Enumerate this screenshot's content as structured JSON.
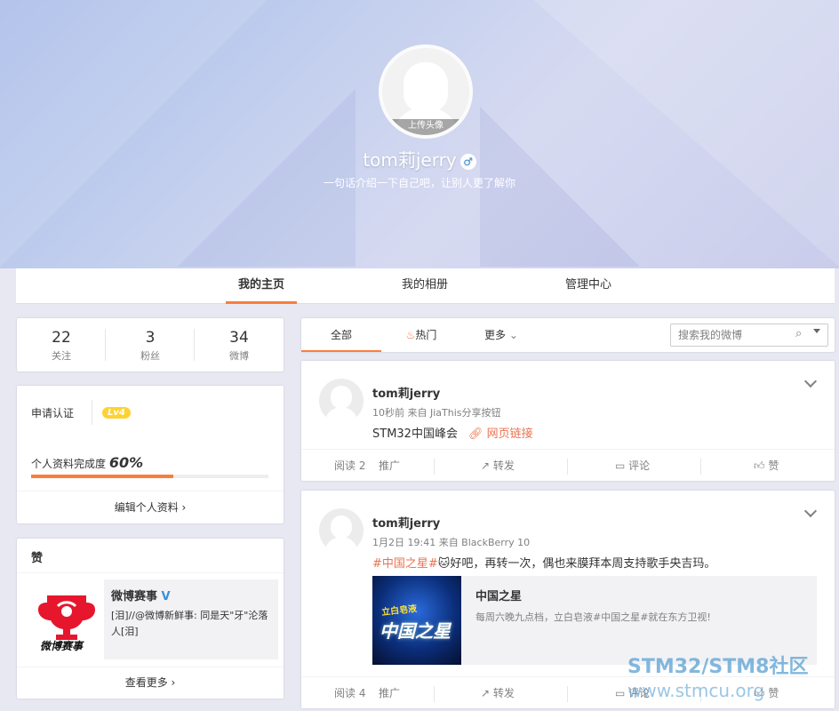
{
  "profile": {
    "upload_label": "上传头像",
    "name": "tom莉jerry",
    "gender_symbol": "♂",
    "intro": "一句话介绍一下自己吧，让别人更了解你"
  },
  "nav": {
    "tabs": [
      "我的主页",
      "我的相册",
      "管理中心"
    ]
  },
  "stats": [
    {
      "num": "22",
      "label": "关注"
    },
    {
      "num": "3",
      "label": "粉丝"
    },
    {
      "num": "34",
      "label": "微博"
    }
  ],
  "profile_card": {
    "verify": "申请认证",
    "level": "Lv4",
    "completeness_label": "个人资料完成度",
    "completeness": "60%",
    "completeness_value": 60,
    "edit": "编辑个人资料 ›"
  },
  "like_card": {
    "title": "赞",
    "account": "微博赛事",
    "logo_text": "微博赛事",
    "text": "[泪]//@微博新鲜事: 同是天\"牙\"沦落人[泪]",
    "more": "查看更多 ›"
  },
  "feed_tabs": {
    "all": "全部",
    "hot": "热门",
    "more": "更多",
    "search_placeholder": "搜索我的微博"
  },
  "posts": [
    {
      "name": "tom莉jerry",
      "meta": "10秒前 来自 JiaThis分享按钮",
      "text": "STM32中国峰会",
      "link": "网页链接",
      "read": "阅读 2",
      "promote": "推广",
      "repost": "转发",
      "comment": "评论",
      "like": "赞"
    },
    {
      "name": "tom莉jerry",
      "meta": "1月2日 19:41 来自 BlackBerry 10",
      "hashtag": "#中国之星#",
      "text": "好吧，再转一次，偶也来膜拜本周支持歌手央吉玛。",
      "card_title": "中国之星",
      "card_desc": "每周六晚九点档，立白皂液#中国之星#就在东方卫视!",
      "thumb_text": "中国之星",
      "thumb_brand": "立白皂液",
      "read": "阅读 4",
      "promote": "推广",
      "repost": "转发",
      "comment": "评论",
      "like": "赞"
    }
  ],
  "watermark": {
    "line1": "STM32/STM8社区",
    "line2": "www.stmcu.org"
  }
}
